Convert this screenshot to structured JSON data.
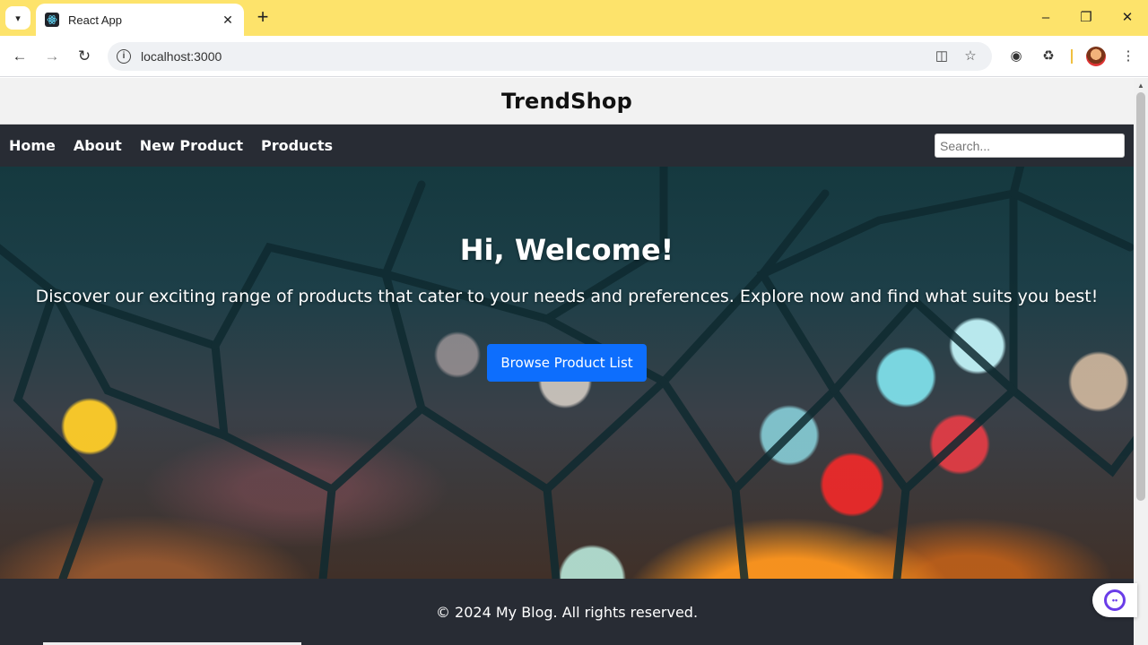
{
  "browser": {
    "tab_title": "React App",
    "url": "localhost:3000",
    "menu_glyph": "▾",
    "close_glyph": "✕",
    "new_tab_glyph": "+"
  },
  "site": {
    "title": "TrendShop",
    "nav": [
      "Home",
      "About",
      "New Product",
      "Products"
    ],
    "search_placeholder": "Search..."
  },
  "hero": {
    "title": "Hi, Welcome!",
    "subtitle": "Discover our exciting range of products that cater to your needs and preferences. Explore now and find what suits you best!",
    "button_label": "Browse Product List"
  },
  "footer": {
    "text": "© 2024 My Blog. All rights reserved."
  },
  "colors": {
    "tabbar": "#fde36b",
    "navbar": "#282c34",
    "accent_button": "#0d6efd"
  }
}
